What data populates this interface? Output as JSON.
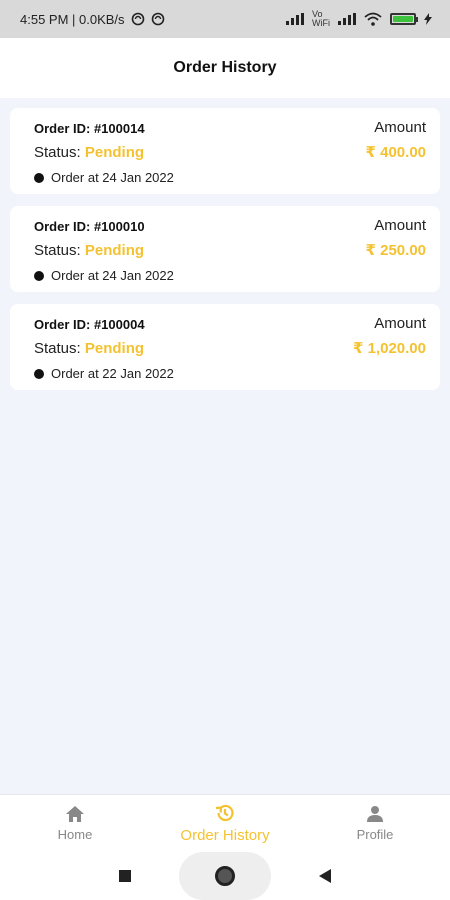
{
  "status_bar": {
    "time_net": "4:55 PM | 0.0KB/s",
    "vo_line1": "Vo",
    "vo_line2": "WiFi"
  },
  "header": {
    "title": "Order History"
  },
  "orders": [
    {
      "id": "Order ID: #100014",
      "status_label": "Status: ",
      "status": "Pending",
      "amount_label": "Amount",
      "amount": "₹ 400.00",
      "date": "Order at 24 Jan 2022"
    },
    {
      "id": "Order ID: #100010",
      "status_label": "Status: ",
      "status": "Pending",
      "amount_label": "Amount",
      "amount": "₹ 250.00",
      "date": "Order at 24 Jan 2022"
    },
    {
      "id": "Order ID: #100004",
      "status_label": "Status: ",
      "status": "Pending",
      "amount_label": "Amount",
      "amount": "₹ 1,020.00",
      "date": "Order at 22 Jan 2022"
    }
  ],
  "bottom_nav": {
    "items": [
      {
        "label": "Home",
        "icon": "home-icon"
      },
      {
        "label": "Order History",
        "icon": "history-icon"
      },
      {
        "label": "Profile",
        "icon": "person-icon"
      }
    ],
    "active_index": 1
  },
  "colors": {
    "accent": "#f4c230",
    "background": "#f1f4fb",
    "card": "#ffffff",
    "inactive": "#888888"
  }
}
